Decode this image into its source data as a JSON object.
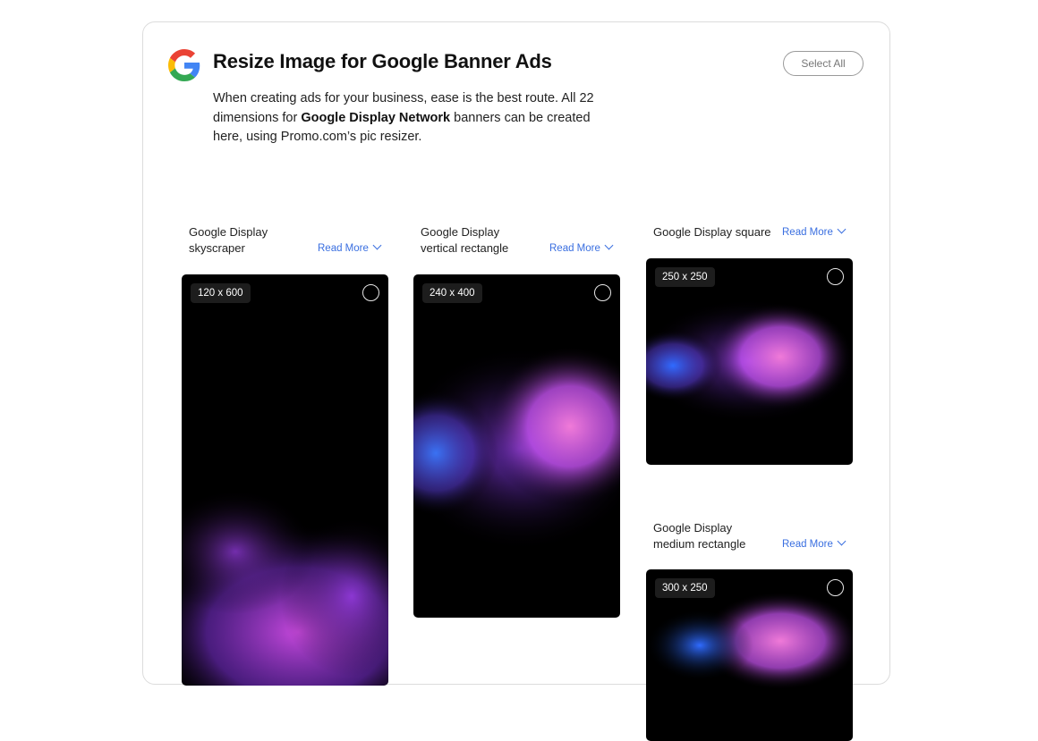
{
  "header": {
    "title": "Resize Image for Google Banner Ads",
    "select_all_label": "Select All",
    "logo_icon": "google-g-logo-icon"
  },
  "description": {
    "text_before": "When creating ads for your business, ease is the best route. All 22 dimensions for ",
    "bold": "Google Display Network",
    "text_after": " banners can be created here, using Promo.com’s pic resizer."
  },
  "read_more_label": "Read More",
  "items": [
    {
      "name_line1": "Google Display",
      "name_line2": "skyscraper",
      "size": "120 x 600",
      "selected": false
    },
    {
      "name_line1": "Google Display",
      "name_line2": "vertical rectangle",
      "size": "240 x 400",
      "selected": false
    },
    {
      "name_line1": "Google Display square",
      "name_line2": "",
      "size": "250 x 250",
      "selected": false
    },
    {
      "name_line1": "Google Display",
      "name_line2": "medium rectangle",
      "size": "300 x 250",
      "selected": false
    }
  ],
  "colors": {
    "accent_link": "#3a6fe0",
    "thumb_bg": "#000000",
    "smoke_pink": "#e85bd0",
    "smoke_purple": "#8a3cf0",
    "smoke_blue": "#2f6bff"
  }
}
